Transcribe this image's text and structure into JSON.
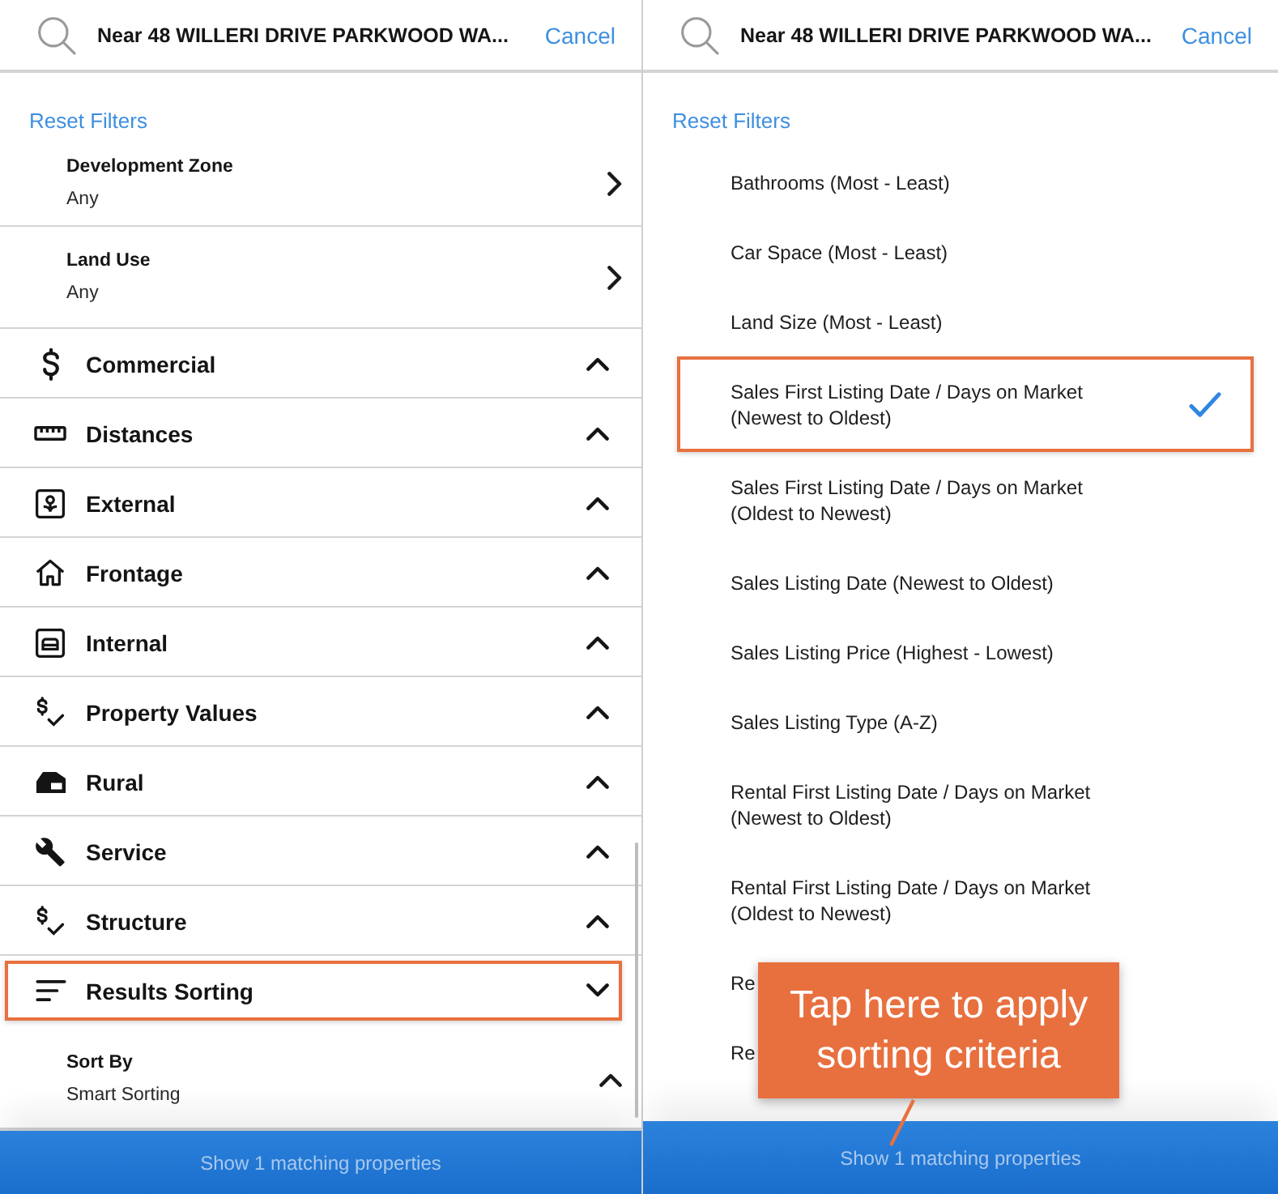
{
  "left_panel": {
    "search": {
      "value": "Near 48 WILLERI DRIVE PARKWOOD WA...",
      "cancel": "Cancel"
    },
    "reset_filters": "Reset Filters",
    "fields": [
      {
        "kind": "page",
        "title": "Development Zone",
        "value": "Any"
      },
      {
        "kind": "page",
        "title": "Land Use",
        "value": "Any"
      }
    ],
    "sections": [
      {
        "label": "Commercial",
        "expanded": false,
        "highlighted": false
      },
      {
        "label": "Distances",
        "expanded": false,
        "highlighted": false
      },
      {
        "label": "External",
        "expanded": false,
        "highlighted": false
      },
      {
        "label": "Frontage",
        "expanded": false,
        "highlighted": false
      },
      {
        "label": "Internal",
        "expanded": false,
        "highlighted": false
      },
      {
        "label": "Property Values",
        "expanded": false,
        "highlighted": false
      },
      {
        "label": "Rural",
        "expanded": false,
        "highlighted": false
      },
      {
        "label": "Service",
        "expanded": false,
        "highlighted": false
      },
      {
        "label": "Structure",
        "expanded": false,
        "highlighted": false
      },
      {
        "label": "Results Sorting",
        "expanded": true,
        "highlighted": true,
        "fields": [
          {
            "kind": "dropdown",
            "title": "Sort By",
            "value": "Smart Sorting"
          }
        ]
      }
    ],
    "footer_button": "Show 1 matching properties"
  },
  "right_panel": {
    "search": {
      "value": "Near 48 WILLERI DRIVE PARKWOOD WA...",
      "cancel": "Cancel"
    },
    "reset_filters": "Reset Filters",
    "sort_options": [
      {
        "label": "Bathrooms (Most - Least)",
        "selected": false,
        "highlighted": false
      },
      {
        "label": "Car Space (Most - Least)",
        "selected": false,
        "highlighted": false
      },
      {
        "label": "Land Size (Most - Least)",
        "selected": false,
        "highlighted": false
      },
      {
        "label": "Sales First Listing Date / Days on Market (Newest to Oldest)",
        "selected": true,
        "highlighted": true
      },
      {
        "label": "Sales First Listing Date / Days on Market (Oldest to Newest)",
        "selected": false,
        "highlighted": false
      },
      {
        "label": "Sales Listing Date (Newest to Oldest)",
        "selected": false,
        "highlighted": false
      },
      {
        "label": "Sales Listing Price (Highest - Lowest)",
        "selected": false,
        "highlighted": false
      },
      {
        "label": "Sales Listing Type (A-Z)",
        "selected": false,
        "highlighted": false
      },
      {
        "label": "Rental First Listing Date / Days on Market (Newest to Oldest)",
        "selected": false,
        "highlighted": false
      },
      {
        "label": "Rental First Listing Date / Days on Market (Oldest to Newest)",
        "selected": false,
        "highlighted": false
      },
      {
        "label": "Re",
        "selected": false,
        "highlighted": false
      },
      {
        "label": "Re",
        "selected": false,
        "highlighted": false
      }
    ],
    "callout": "Tap here to apply sorting criteria",
    "footer_button": "Show 1 matching properties"
  }
}
